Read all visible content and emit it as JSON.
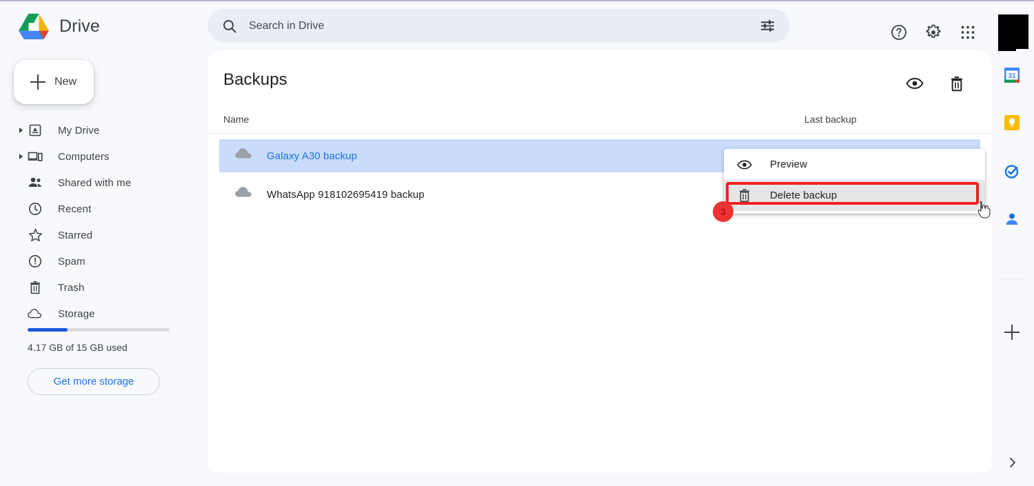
{
  "app": {
    "brand": "Drive",
    "logo_icon": "google-drive-logo"
  },
  "sidebar": {
    "new_button": {
      "label": "New",
      "icon": "plus-icon"
    },
    "items": [
      {
        "label": "My Drive",
        "icon": "drive-box-icon",
        "expandable": true
      },
      {
        "label": "Computers",
        "icon": "computer-icon",
        "expandable": true
      },
      {
        "label": "Shared with me",
        "icon": "people-icon",
        "expandable": false
      },
      {
        "label": "Recent",
        "icon": "clock-icon",
        "expandable": false
      },
      {
        "label": "Starred",
        "icon": "star-icon",
        "expandable": false
      },
      {
        "label": "Spam",
        "icon": "exclamation-icon",
        "expandable": false
      },
      {
        "label": "Trash",
        "icon": "trash-icon",
        "expandable": false
      },
      {
        "label": "Storage",
        "icon": "cloud-icon",
        "expandable": false
      }
    ],
    "storage": {
      "used_text": "4.17 GB of 15 GB used",
      "percent": 28,
      "bar_color": "#1a56db",
      "cta_label": "Get more storage",
      "cta_color": "#1a73e8"
    }
  },
  "search": {
    "placeholder": "Search in Drive",
    "search_icon": "search-icon",
    "filter_icon": "tune-icon",
    "background": "#e9eef6"
  },
  "topbar": {
    "icons": [
      {
        "name": "help-icon"
      },
      {
        "name": "settings-gear-icon"
      },
      {
        "name": "apps-grid-icon"
      }
    ],
    "avatar": {
      "name": "avatar",
      "redacted": true
    }
  },
  "main": {
    "title": "Backups",
    "actions": [
      {
        "name": "preview-eye-icon",
        "icon": "eye-icon"
      },
      {
        "name": "delete-trash-icon",
        "icon": "trash-icon"
      }
    ],
    "columns": {
      "name": "Name",
      "last_backup": "Last backup"
    },
    "rows": [
      {
        "name": "Galaxy A30 backup",
        "icon": "cloud-icon",
        "last_backup": "",
        "selected": true
      },
      {
        "name": "WhatsApp 918102695419 backup",
        "icon": "cloud-icon",
        "last_backup": "",
        "selected": false
      }
    ]
  },
  "context_menu": {
    "items": [
      {
        "label": "Preview",
        "icon": "eye-icon",
        "highlighted": false
      },
      {
        "label": "Delete backup",
        "icon": "trash-icon",
        "highlighted": true
      }
    ]
  },
  "annotation": {
    "step_badge": "3",
    "badge_color": "#ee3333",
    "highlight_color": "#ee2222"
  },
  "right_rail": {
    "items": [
      {
        "name": "google-calendar-icon",
        "label": "31"
      },
      {
        "name": "google-keep-icon"
      },
      {
        "name": "google-tasks-icon"
      },
      {
        "name": "google-contacts-icon"
      }
    ],
    "add_label": "+",
    "expand_icon": "chevron-right-icon"
  }
}
